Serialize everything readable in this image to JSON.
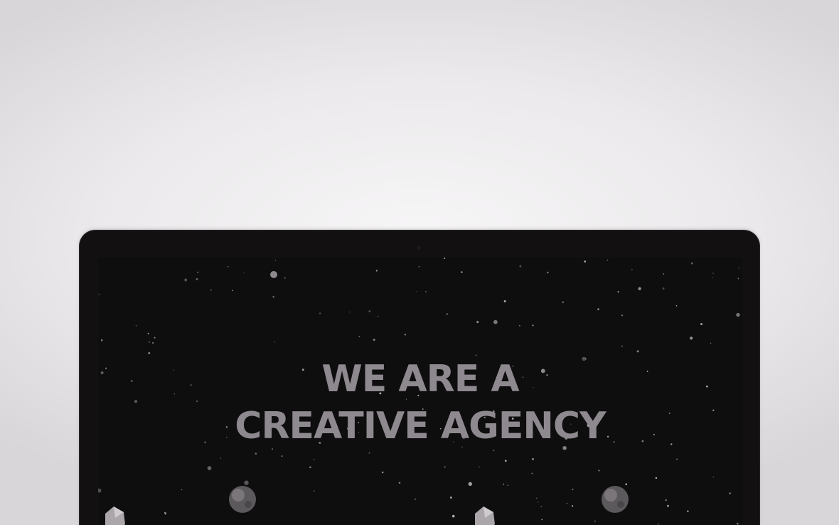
{
  "hero": {
    "line1": "WE ARE A",
    "line2": "CREATIVE AGENCY"
  },
  "colors": {
    "background": "#eeeeef",
    "monitor_bezel": "#121011",
    "screen": "#0f0e0f",
    "headline": "#8e898e",
    "stars": "#b9b5b9"
  },
  "icons": {
    "camera": "camera-dot-icon",
    "planet": "planet-icon",
    "gem": "gem-icon",
    "star": "star-icon"
  }
}
